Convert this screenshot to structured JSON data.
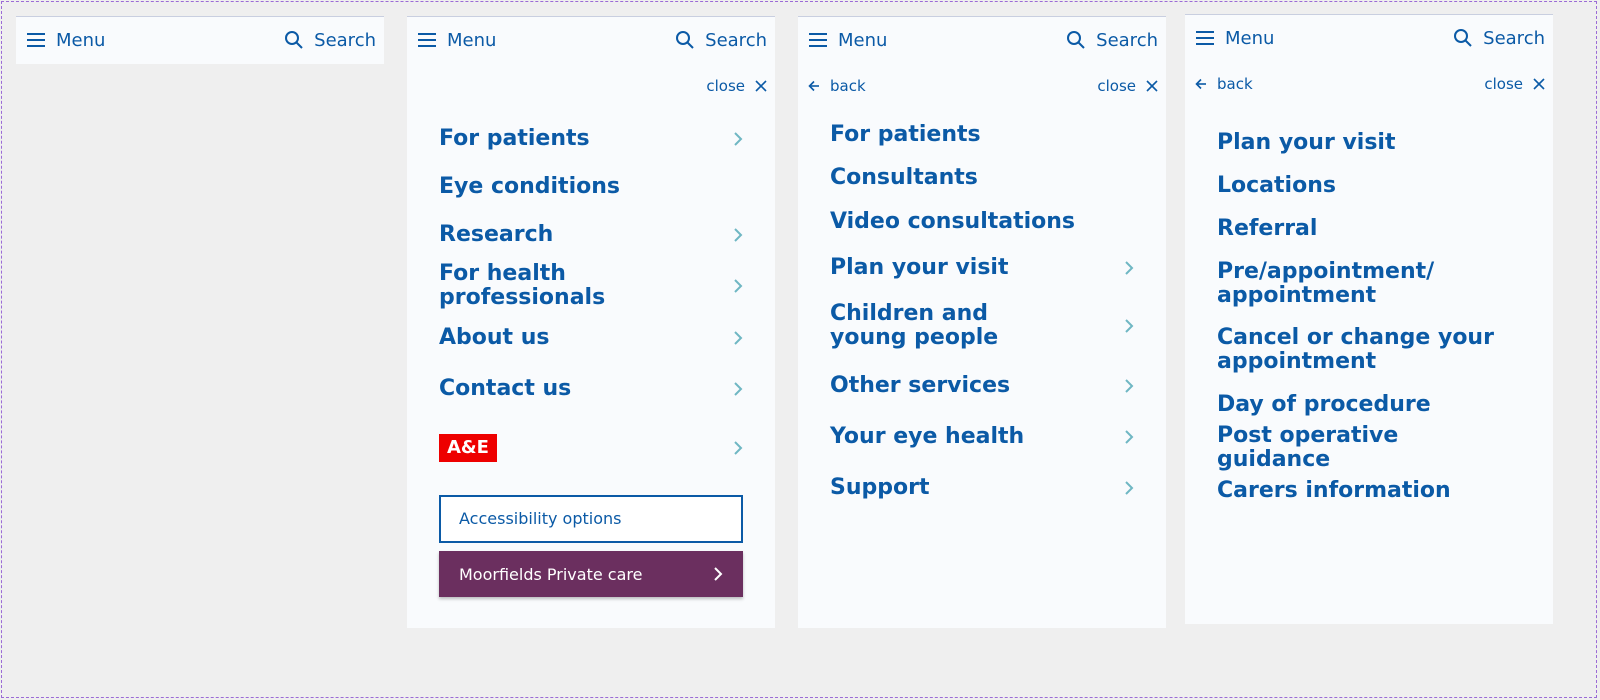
{
  "topbar": {
    "menu_label": "Menu",
    "search_label": "Search"
  },
  "controls": {
    "close_label": "close",
    "back_label": "back"
  },
  "panel2": {
    "items": [
      {
        "label": "For patients",
        "has_children": true
      },
      {
        "label": "Eye conditions",
        "has_children": false
      },
      {
        "label": "Research",
        "has_children": true
      },
      {
        "label": "For health professionals",
        "has_children": true
      },
      {
        "label": "About us",
        "has_children": true
      },
      {
        "label": "Contact us",
        "has_children": true
      }
    ],
    "ae_label": "A&E",
    "accessibility_label": "Accessibility options",
    "private_care_label": "Moorfields Private care"
  },
  "panel3": {
    "items": [
      {
        "label": "For patients",
        "has_children": false
      },
      {
        "label": "Consultants",
        "has_children": false
      },
      {
        "label": "Video consultations",
        "has_children": false
      },
      {
        "label": "Plan your visit",
        "has_children": true
      },
      {
        "label": "Children and young people",
        "has_children": true
      },
      {
        "label": "Other services",
        "has_children": true
      },
      {
        "label": "Your eye health",
        "has_children": true
      },
      {
        "label": "Support",
        "has_children": true
      }
    ]
  },
  "panel4": {
    "items": [
      {
        "label": "Plan your visit"
      },
      {
        "label": "Locations"
      },
      {
        "label": "Referral"
      },
      {
        "label": "Pre/appointment/ appointment"
      },
      {
        "label": "Cancel or change your appointment"
      },
      {
        "label": "Day of procedure"
      },
      {
        "label": "Post operative guidance"
      },
      {
        "label": "Carers information"
      }
    ]
  },
  "colors": {
    "brand_blue": "#0b5aa6",
    "chevron_teal": "#6fb7c3",
    "ae_red": "#ee0000",
    "private_purple": "#6b2f5f",
    "panel_bg": "#f9fbfd",
    "page_bg": "#efefef"
  },
  "icons": {
    "menu": "hamburger-icon",
    "search": "search-icon",
    "close": "close-icon",
    "back": "arrow-left-icon",
    "submenu": "chevron-right-icon"
  }
}
